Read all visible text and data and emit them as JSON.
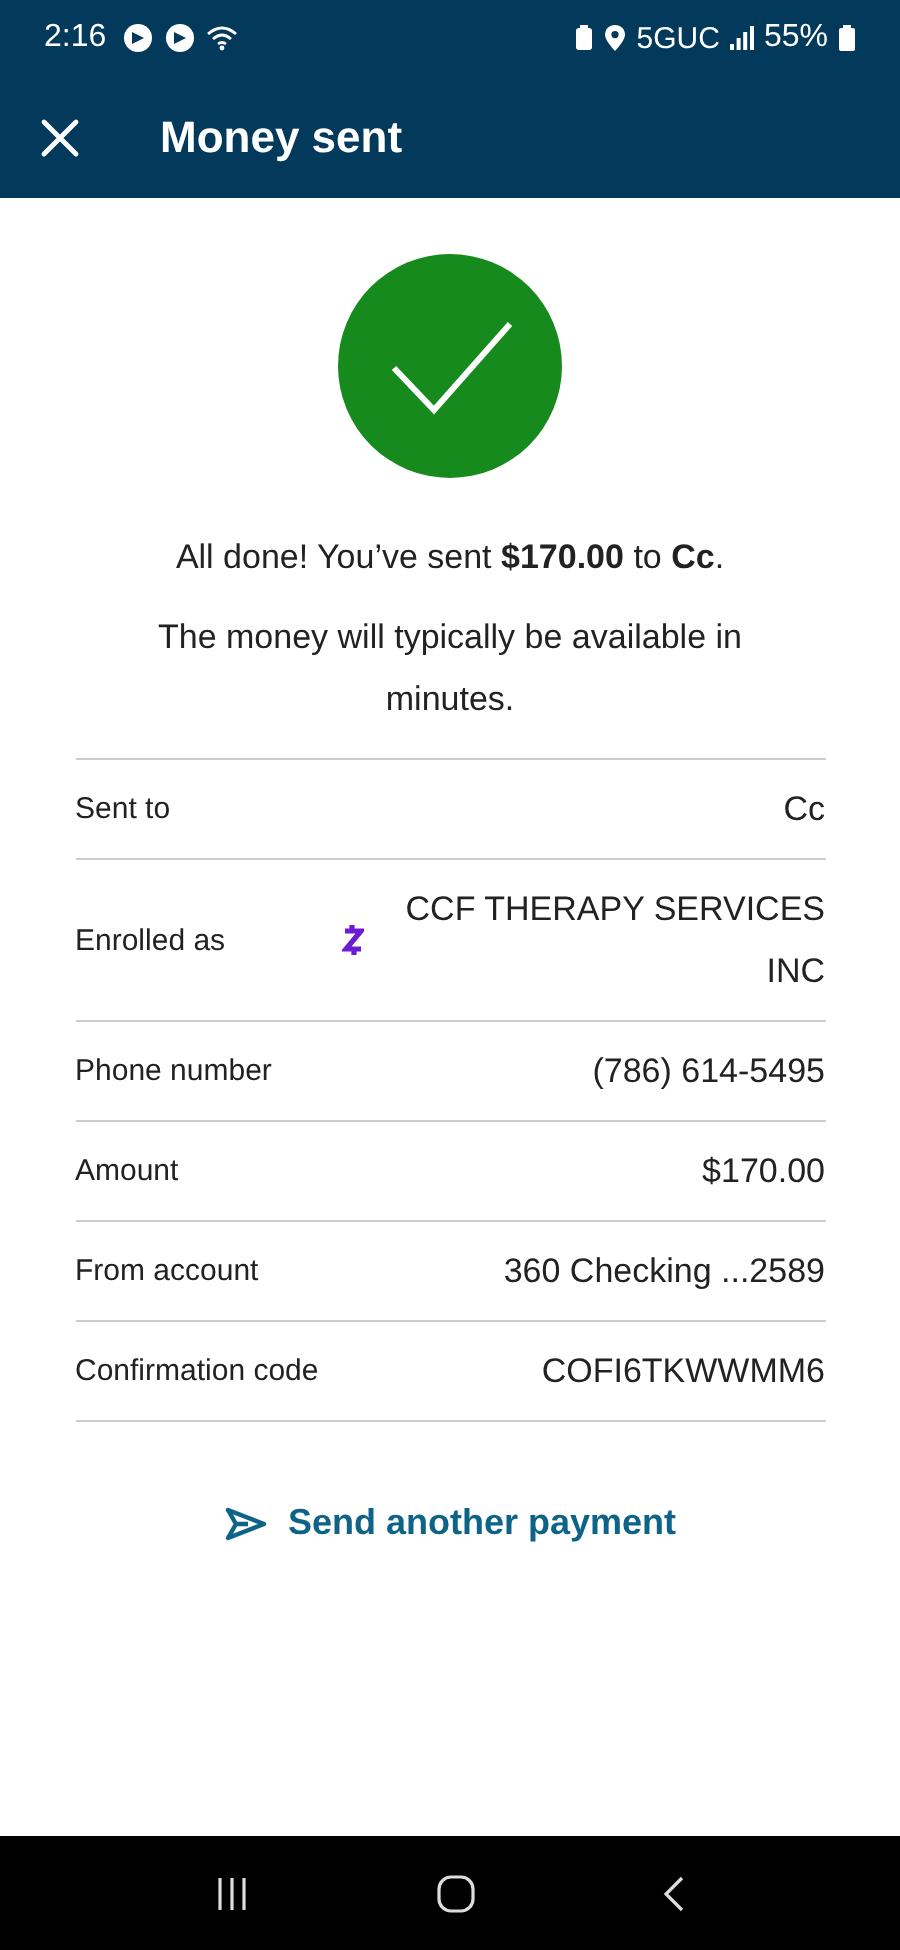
{
  "status_bar": {
    "time": "2:16",
    "network": "5GUC",
    "battery": "55%"
  },
  "header": {
    "title": "Money sent"
  },
  "message": "All done! You’ve sent **$170.00** to **Cc**.",
  "note": "The money will typically be available in minutes.",
  "details": [
    {
      "kind": "plain",
      "label": "Sent to",
      "value": "Cc"
    },
    {
      "kind": "zelle",
      "label": "Enrolled as",
      "value": "CCF THERAPY SERVICES INC"
    },
    {
      "kind": "plain",
      "label": "Phone number",
      "value": "(786) 614-5495"
    },
    {
      "kind": "plain",
      "label": "Amount",
      "value": "$170.00"
    },
    {
      "kind": "plain",
      "label": "From account",
      "value": "360 Checking ...2589"
    },
    {
      "kind": "plain",
      "label": "Confirmation code",
      "value": "COFI6TKWWMM6"
    }
  ],
  "action": {
    "label": "Send another payment"
  }
}
